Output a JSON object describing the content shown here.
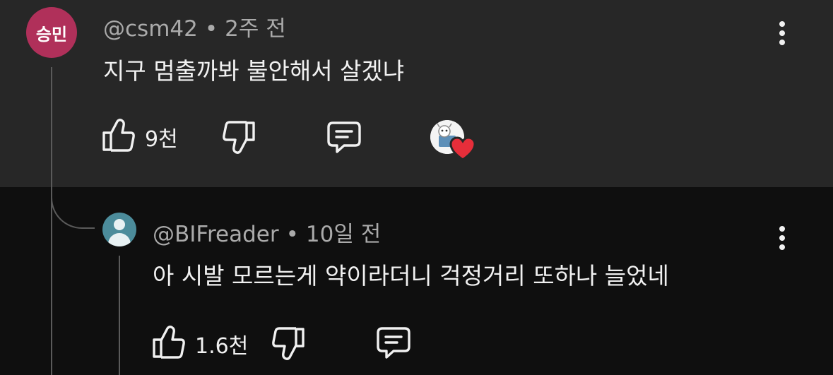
{
  "comments": [
    {
      "author": "@csm42",
      "time": "2주 전",
      "avatar_text": "승민",
      "avatar_color": "#b0305a",
      "text": "지구 멈출까봐 불안해서 살겠냐",
      "likes": "9천",
      "creator_heart": true
    },
    {
      "author": "@BIFreader",
      "time": "10일 전",
      "avatar_color": "#4c8c9b",
      "text": "아 시발 모르는게 약이라더니 걱정거리 또하나 늘었네",
      "likes": "1.6천"
    }
  ],
  "separator": "•",
  "icons": {
    "like": "thumbs-up-icon",
    "dislike": "thumbs-down-icon",
    "reply": "reply-comment-icon",
    "menu": "more-vertical-icon",
    "heart": "heart-icon"
  },
  "colors": {
    "highlight_bg": "#272727",
    "page_bg": "#0f0f0f",
    "heart": "#e62e3a"
  }
}
